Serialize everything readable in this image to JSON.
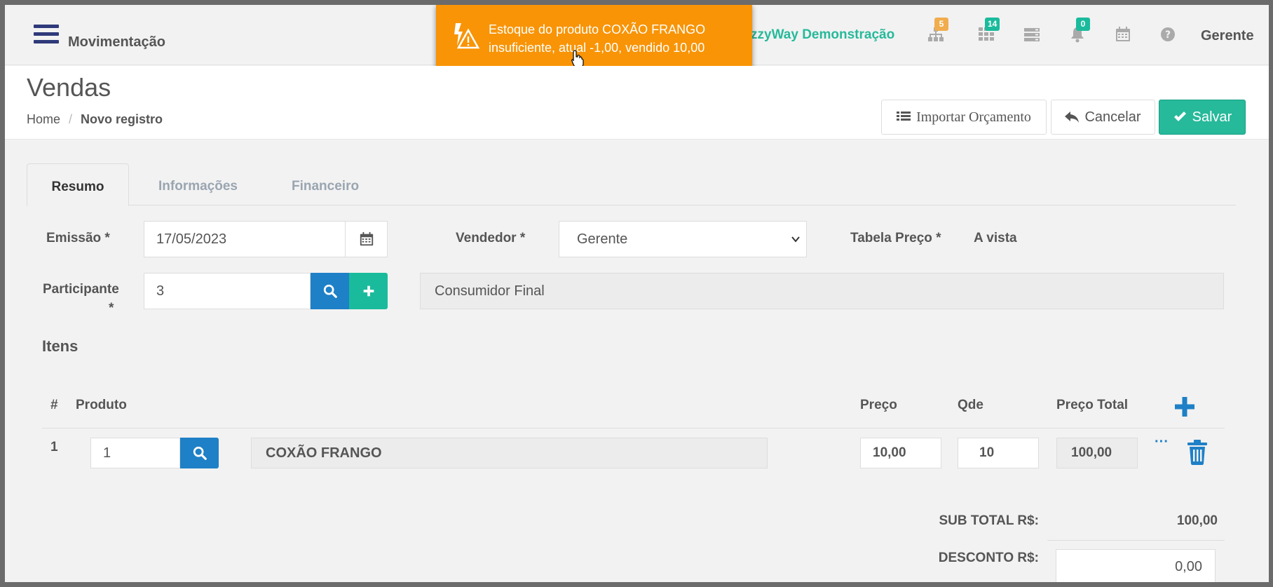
{
  "header": {
    "module_title": "Movimentação",
    "company": "zzyWay Demonstração",
    "user": "Gerente",
    "badges": {
      "network": "5",
      "apps": "14",
      "notifications": "0"
    },
    "colors": {
      "accent": "#26b99a",
      "brand": "#2f3a7a",
      "warning": "#f89406",
      "primary": "#1e80c6"
    }
  },
  "toast": {
    "message": "Estoque do produto COXÃO FRANGO insuficiente, atual -1,00, vendido 10,00",
    "icon": "warning-icon"
  },
  "page": {
    "title": "Vendas",
    "breadcrumb": {
      "home": "Home",
      "separator": "/",
      "current": "Novo registro"
    },
    "buttons": {
      "import": "Importar Orçamento",
      "cancel": "Cancelar",
      "save": "Salvar"
    }
  },
  "tabs": [
    "Resumo",
    "Informações",
    "Financeiro"
  ],
  "form": {
    "emissao_label": "Emissão *",
    "emissao_value": "17/05/2023",
    "vendedor_label": "Vendedor *",
    "vendedor_value": "Gerente",
    "tabela_label": "Tabela Preço *",
    "tabela_value": "A vista",
    "participante_label_1": "Participante",
    "participante_label_2": "*",
    "participante_code": "3",
    "participante_name": "Consumidor Final"
  },
  "itens": {
    "title": "Itens",
    "columns": {
      "num": "#",
      "produto": "Produto",
      "preco": "Preço",
      "qde": "Qde",
      "total": "Preço Total"
    },
    "rows": [
      {
        "num": "1",
        "code": "1",
        "produto": "COXÃO FRANGO",
        "preco": "10,00",
        "qde": "10",
        "total": "100,00",
        "more": "···"
      }
    ]
  },
  "totals": {
    "subtotal_label": "SUB TOTAL R$:",
    "subtotal_value": "100,00",
    "desconto_label": "DESCONTO R$:",
    "desconto_value": "0,00"
  }
}
